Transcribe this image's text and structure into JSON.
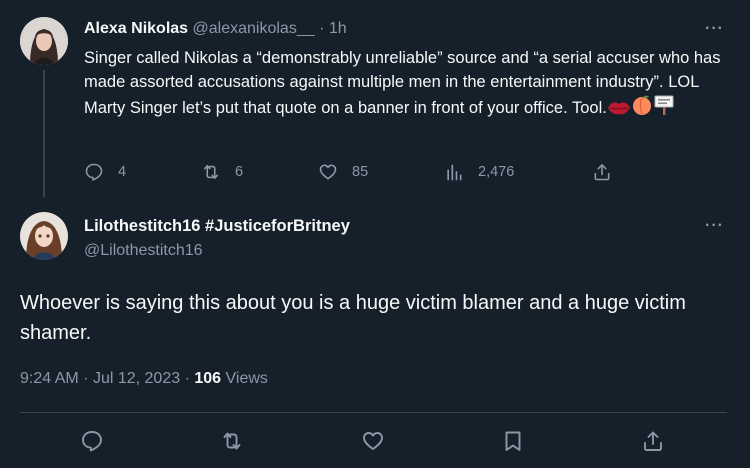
{
  "reply_parent": {
    "author_name": "Alexa Nikolas",
    "author_handle": "@alexanikolas__",
    "separator": "·",
    "time_ago": "1h",
    "more": "···",
    "text": "Singer called Nikolas a “demonstrably unreliable” source and “a serial accuser who has made assorted accusations against multiple men in the entertainment industry”. LOL Marty Singer let’s put that quote on a banner in front of your office. Tool.",
    "emojis": [
      "lips-emoji",
      "peach-emoji",
      "placard-emoji"
    ],
    "stats": {
      "replies": "4",
      "reposts": "6",
      "likes": "85",
      "views": "2,476"
    }
  },
  "main_tweet": {
    "author_name": "Lilothestitch16 #JusticeforBritney",
    "author_handle": "@Lilothestitch16",
    "more": "···",
    "text": "Whoever is saying this about you is a huge victim blamer and a huge victim shamer.",
    "time": "9:24 AM",
    "separator": "·",
    "date": "Jul 12, 2023",
    "separator2": "·",
    "views_count": "106",
    "views_label": "Views"
  },
  "colors": {
    "background": "#15202b",
    "text": "#f7f9f9",
    "muted": "#8b98a5",
    "divider": "#38444d"
  }
}
